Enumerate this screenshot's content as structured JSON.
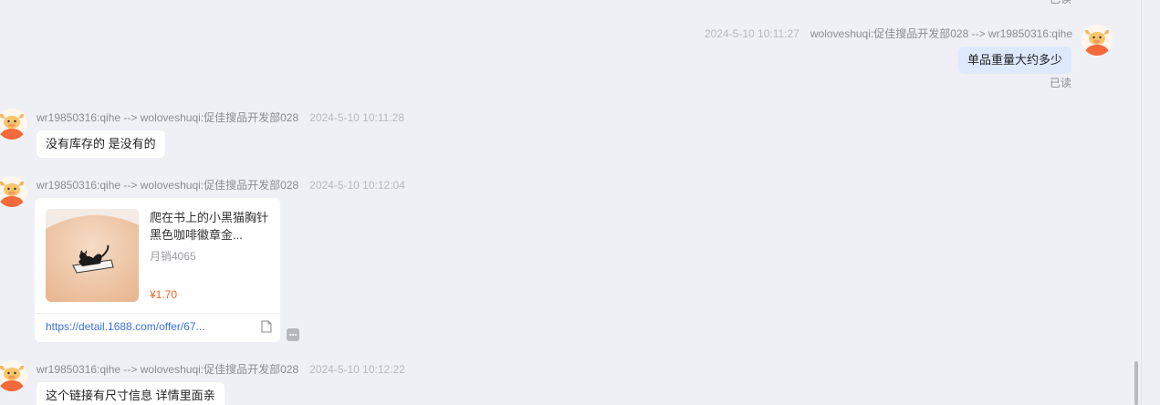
{
  "messages": [
    {
      "time": "2024-5-10 10:11:27",
      "from_to": "woloveshuqi:促佳搜品开发部028 --> wr19850316:qihe",
      "text": "单品重量大约多少",
      "read_status": "已读"
    },
    {
      "from_to": "wr19850316:qihe --> woloveshuqi:促佳搜品开发部028",
      "time": "2024-5-10 10:11:28",
      "text": "没有库存的 是没有的"
    },
    {
      "from_to": "wr19850316:qihe --> woloveshuqi:促佳搜品开发部028",
      "time": "2024-5-10 10:12:04",
      "product": {
        "title": "爬在书上的小黑猫胸针黑色咖啡徽章金...",
        "sales": "月销4065",
        "price": "¥1.70",
        "link": "https://detail.1688.com/offer/67..."
      }
    },
    {
      "from_to": "wr19850316:qihe --> woloveshuqi:促佳搜品开发部028",
      "time": "2024-5-10 10:12:22",
      "text": "这个链接有尺寸信息 详情里面亲"
    }
  ],
  "top_partial_read": "已读",
  "icons": {
    "avatar": "cow-avatar-icon",
    "doc": "document-icon",
    "more": "more-icon"
  },
  "colors": {
    "background": "#eff0f5",
    "my_bubble": "#dee9fd",
    "their_bubble": "#ffffff",
    "link": "#3a72d8",
    "price": "#f2641f"
  }
}
